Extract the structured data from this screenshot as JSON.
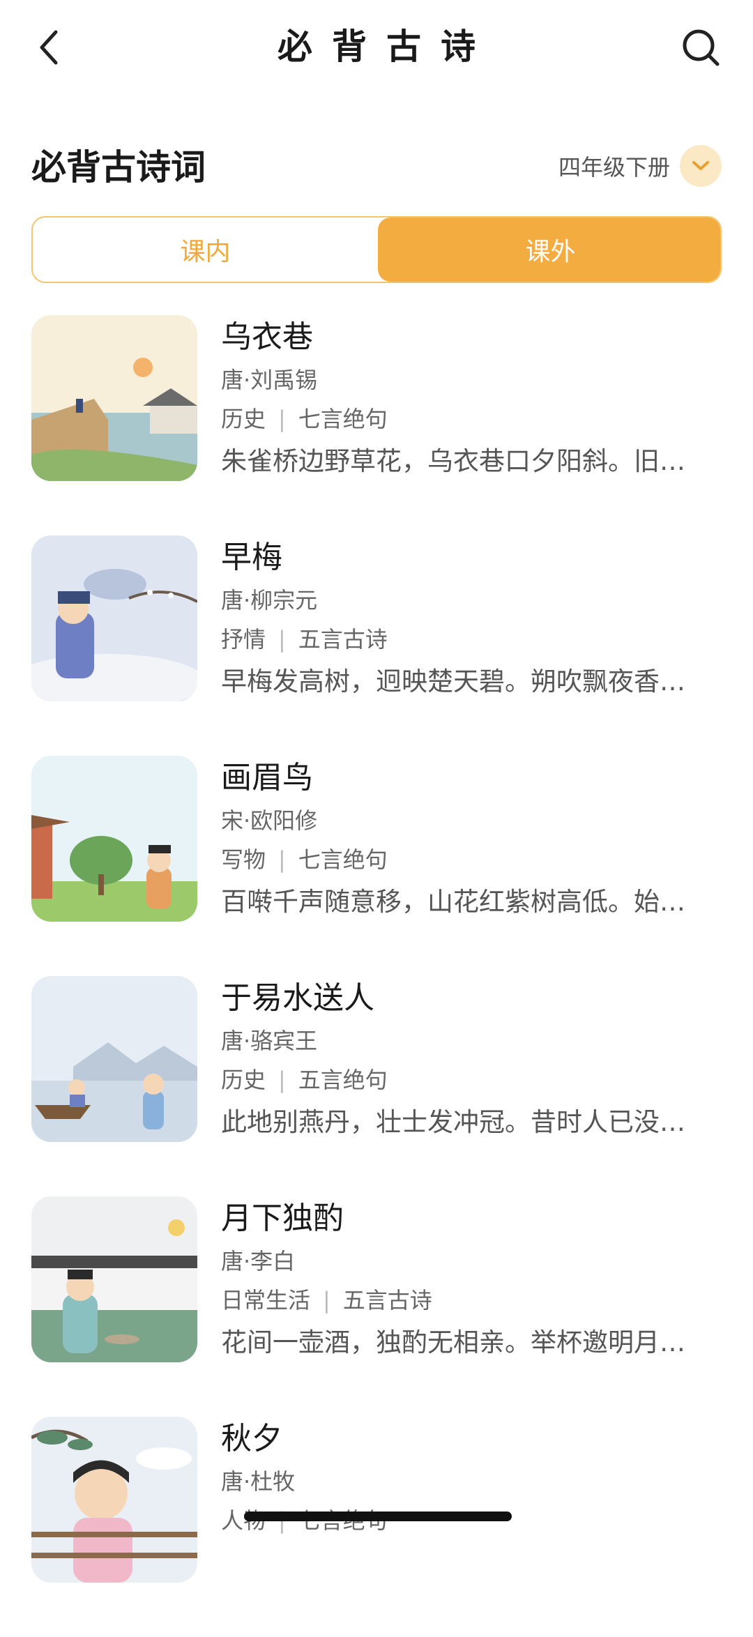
{
  "header": {
    "title": "必背古诗",
    "back_icon": "chevron-left-icon",
    "search_icon": "search-icon"
  },
  "section": {
    "title": "必背古诗词",
    "grade": "四年级下册"
  },
  "tabs": [
    {
      "label": "课内",
      "active": false
    },
    {
      "label": "课外",
      "active": true
    }
  ],
  "colors": {
    "accent": "#f3ac3f",
    "accent_light": "#fbe9c6"
  },
  "poems": [
    {
      "title": "乌衣巷",
      "author": "唐·刘禹锡",
      "theme": "历史",
      "form": "七言绝句",
      "excerpt": "朱雀桥边野草花，乌衣巷口夕阳斜。旧时王谢堂前燕，飞入寻常百姓家。"
    },
    {
      "title": "早梅",
      "author": "唐·柳宗元",
      "theme": "抒情",
      "form": "五言古诗",
      "excerpt": "早梅发高树，迥映楚天碧。朔吹飘夜香，繁霜滋晓白。"
    },
    {
      "title": "画眉鸟",
      "author": "宋·欧阳修",
      "theme": "写物",
      "form": "七言绝句",
      "excerpt": "百啭千声随意移，山花红紫树高低。始知锁向金笼听，不及林间自在啼。"
    },
    {
      "title": "于易水送人",
      "author": "唐·骆宾王",
      "theme": "历史",
      "form": "五言绝句",
      "excerpt": "此地别燕丹，壮士发冲冠。昔时人已没，今日水犹寒。"
    },
    {
      "title": "月下独酌",
      "author": "唐·李白",
      "theme": "日常生活",
      "form": "五言古诗",
      "excerpt": "花间一壶酒，独酌无相亲。举杯邀明月，对影成三人。"
    },
    {
      "title": "秋夕",
      "author": "唐·杜牧",
      "theme": "人物",
      "form": "七言绝句",
      "excerpt": ""
    }
  ]
}
